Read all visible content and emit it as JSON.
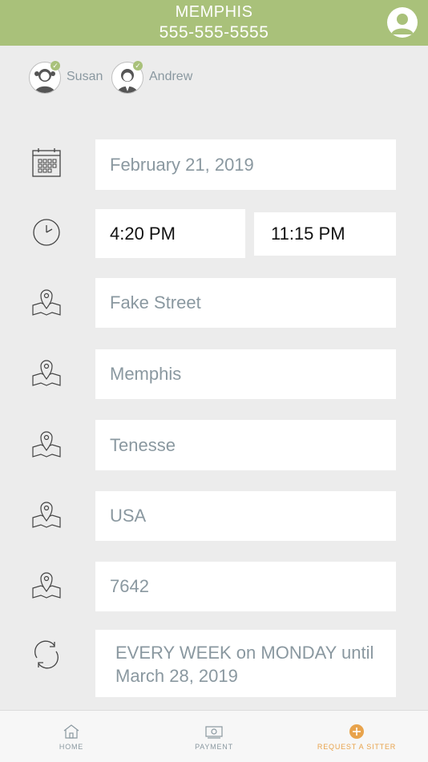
{
  "header": {
    "city": "MEMPHIS",
    "phone": "555-555-5555",
    "profile_icon": "user-avatar-icon"
  },
  "kids": [
    {
      "name": "Susan",
      "selected": true
    },
    {
      "name": "Andrew",
      "selected": true
    }
  ],
  "form": {
    "date": "February 21, 2019",
    "start_time": "4:20 PM",
    "end_time": "11:15 PM",
    "street": "Fake Street",
    "city": "Memphis",
    "state": "Tenesse",
    "country": "USA",
    "zip": "7642",
    "recurrence": "EVERY WEEK on MONDAY until March 28, 2019"
  },
  "tabs": [
    {
      "label": "HOME",
      "icon": "home-icon"
    },
    {
      "label": "PAYMENT",
      "icon": "payment-icon"
    },
    {
      "label": "REQUEST A SITTER",
      "icon": "plus-circle-icon",
      "active": true
    }
  ],
  "colors": {
    "header": "#a9c17a",
    "accent": "#e8a34c",
    "text_muted": "#8a98a0"
  }
}
